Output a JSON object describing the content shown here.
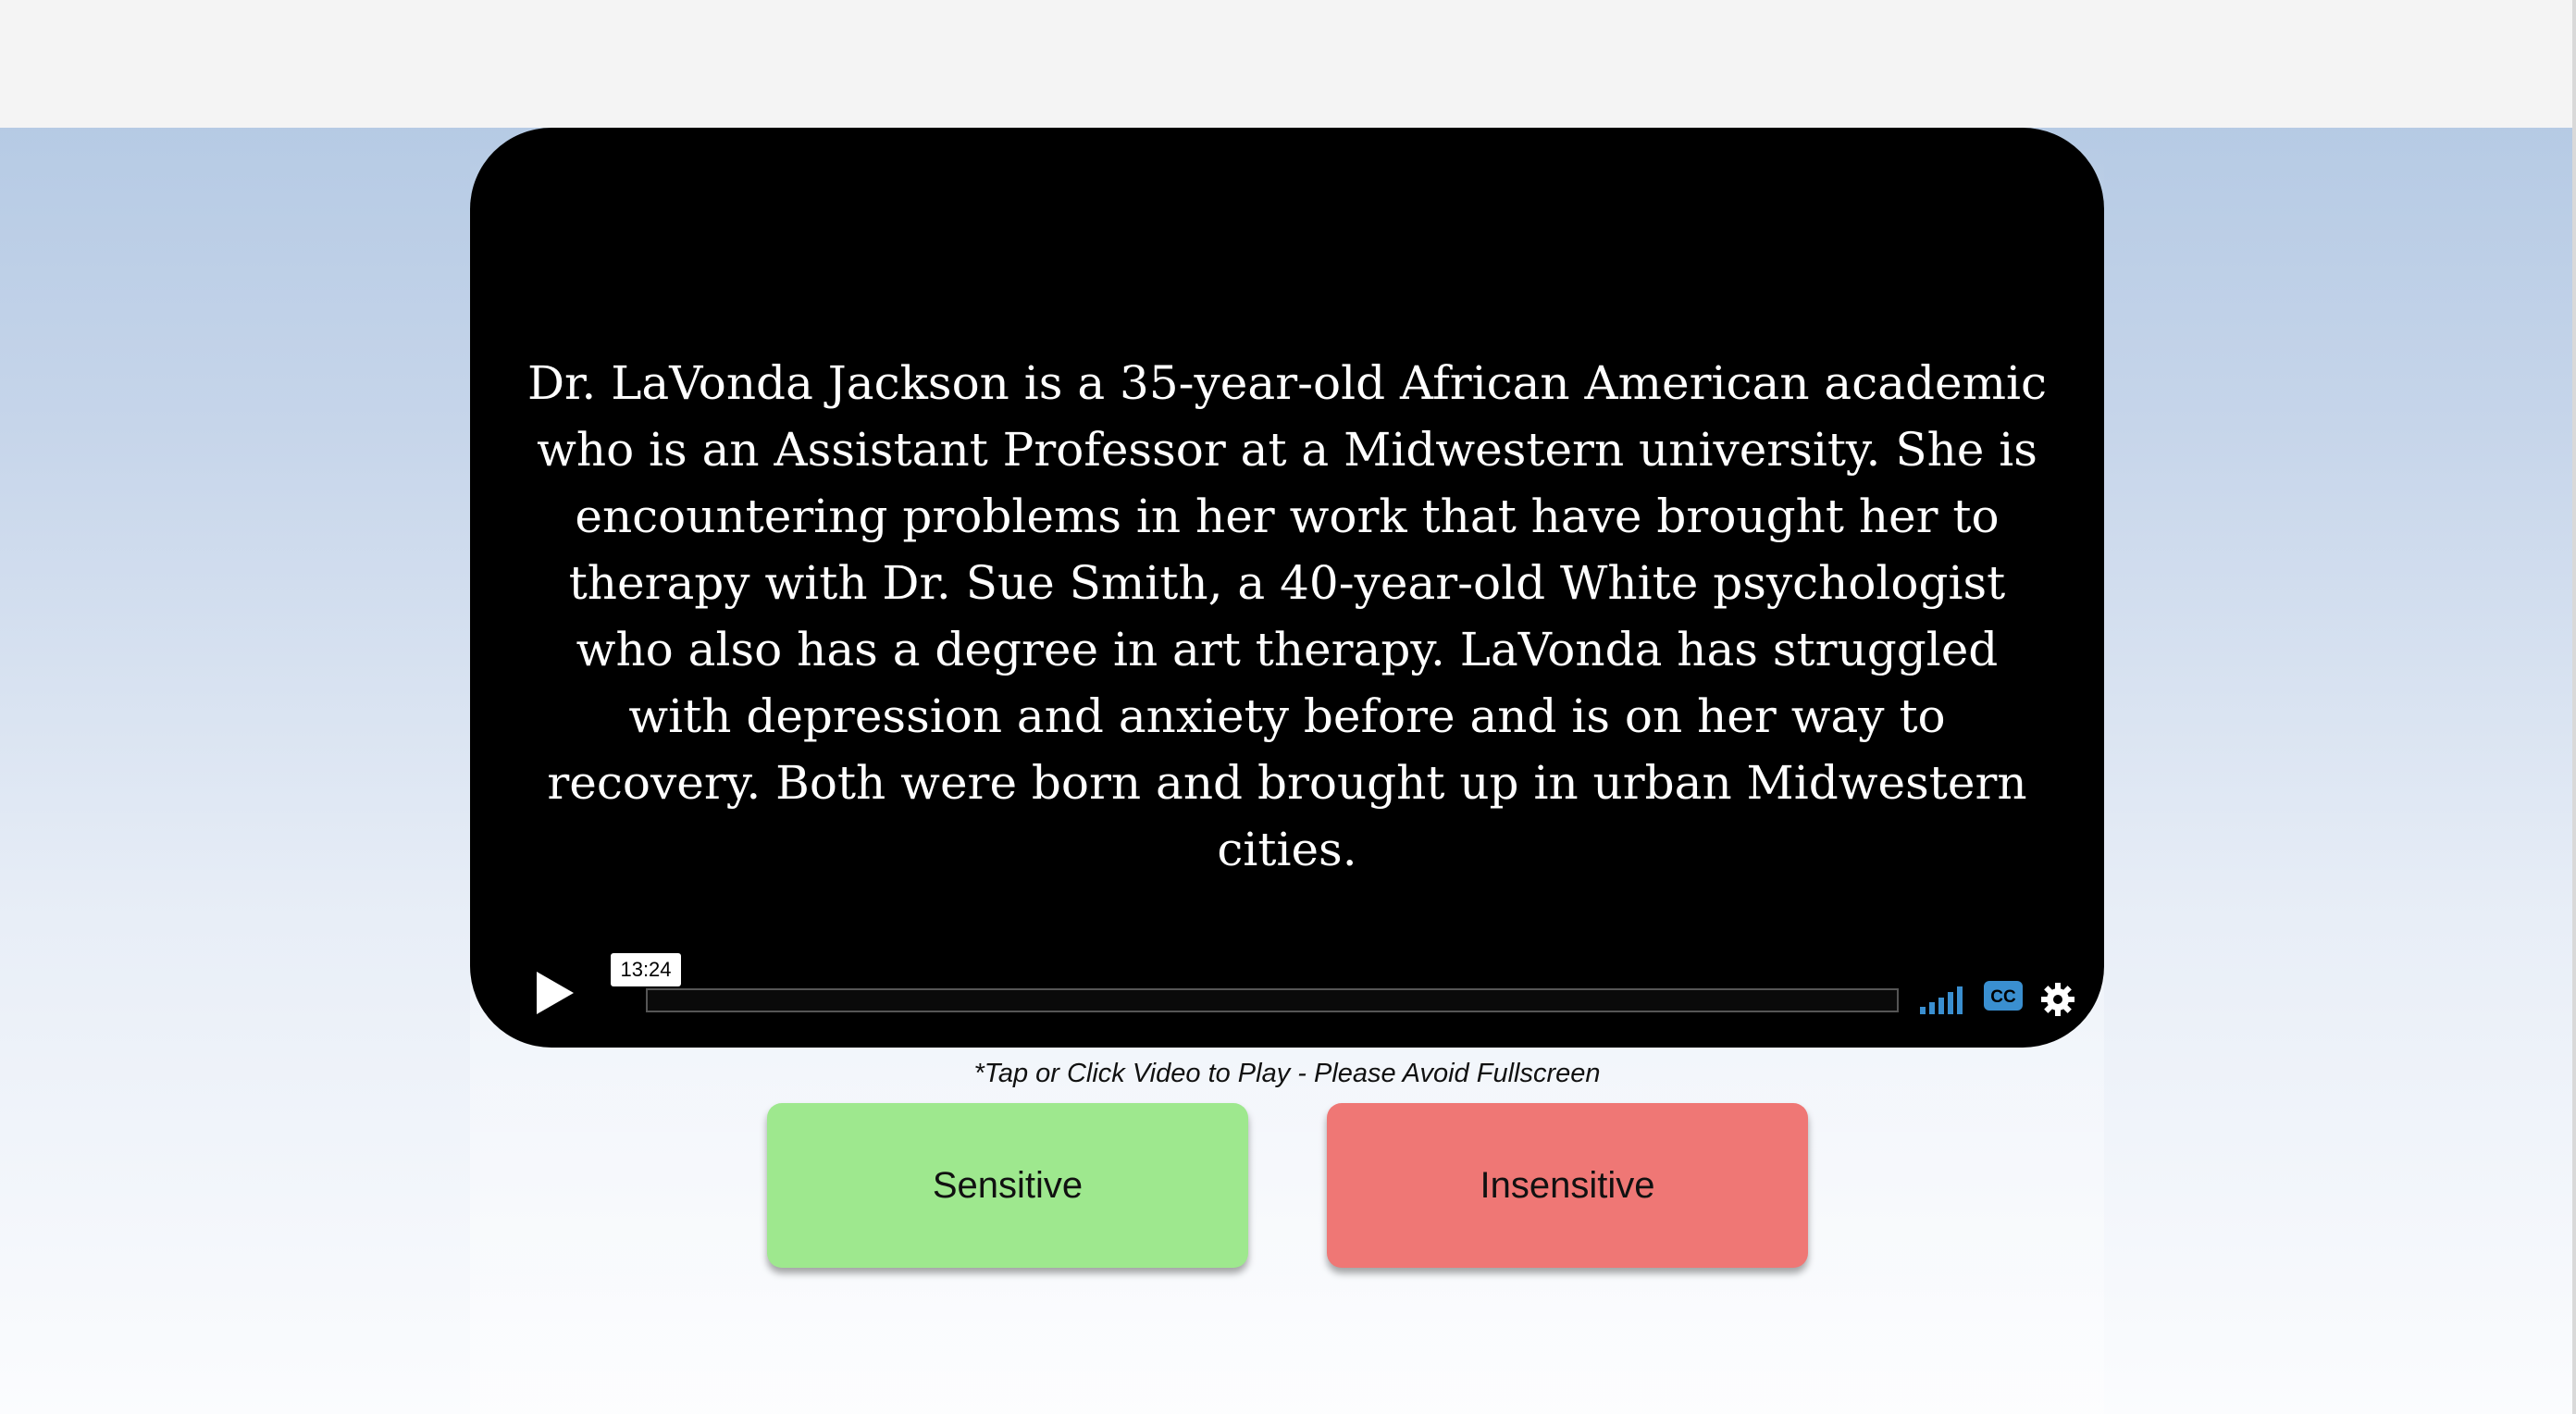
{
  "video": {
    "description_text": "Dr. LaVonda Jackson is a 35-year-old African American academic who is an Assistant Professor at a Midwestern university. She is encountering problems in her work that have brought her to therapy with Dr. Sue Smith, a 40-year-old White psychologist who also has a degree in art therapy. LaVonda has struggled with depression and anxiety before and is on her way to recovery. Both were born and brought up in urban Midwestern cities.",
    "time_tooltip": "13:24",
    "progress_fraction": 0,
    "controls": {
      "play_icon": "play-icon",
      "volume_icon": "volume-bars-icon",
      "cc_label": "CC",
      "settings_icon": "gear-icon"
    },
    "accent_color": "#3a8fd0"
  },
  "caption": "*Tap or Click Video to Play - Please Avoid Fullscreen",
  "buttons": {
    "sensitive": {
      "label": "Sensitive",
      "color": "#9ee88e"
    },
    "insensitive": {
      "label": "Insensitive",
      "color": "#ef7775"
    }
  }
}
